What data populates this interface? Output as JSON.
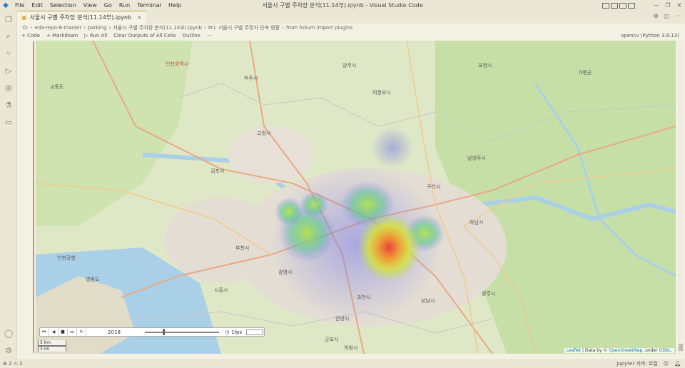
{
  "window": {
    "title": "서울시 구별 주차장 분석(11.14부).ipynb - Visual Studio Code",
    "menu": [
      "File",
      "Edit",
      "Selection",
      "View",
      "Go",
      "Run",
      "Terminal",
      "Help"
    ]
  },
  "tab": {
    "label": "서울시 구별 주차장 분석(11.14부).ipynb",
    "close": "×"
  },
  "breadcrumb": [
    "D:",
    "eda-repo-6-master",
    "parking",
    "서울시 구별 주차장 분석(11.14부).ipynb",
    "M↓ 서울시 구별 주정차 단속 현황",
    "from folium import plugins"
  ],
  "toolbar": {
    "code": "+ Code",
    "markdown": "+ Markdown",
    "run_all": "▷ Run All",
    "clear": "Clear Outputs of All Cells",
    "outline": "Outline",
    "more": "···",
    "kernel": "opencv (Python 3.8.13)"
  },
  "time_control": {
    "date": "2018",
    "fps": "1fps",
    "slider_fraction": 0.25
  },
  "scale": {
    "km": "5 km",
    "mi": "3 mi"
  },
  "attribution": {
    "leaflet": "Leaflet",
    "data": " | Data by © ",
    "osm": "OpenStreetMap",
    "under": ", under ",
    "license": "ODbL."
  },
  "map_labels": [
    "파주시",
    "고양시",
    "김포시",
    "의정부시",
    "양주시",
    "남양주시",
    "구리시",
    "하남시",
    "부천시",
    "인천광역시",
    "시흥시",
    "광명시",
    "안양시",
    "과천시",
    "성남시",
    "군포시",
    "의왕시",
    "가평군",
    "포천시",
    "광주시",
    "인천공항",
    "영종도",
    "교동도"
  ],
  "status": {
    "left": "⊗ 2 ⚠ 2",
    "jupyter": "Jupyter 서버: 로컬"
  },
  "colors": {
    "heat_high": "#e8413a",
    "heat_mid": "#b7e24b",
    "heat_low": "#7b7de8"
  }
}
